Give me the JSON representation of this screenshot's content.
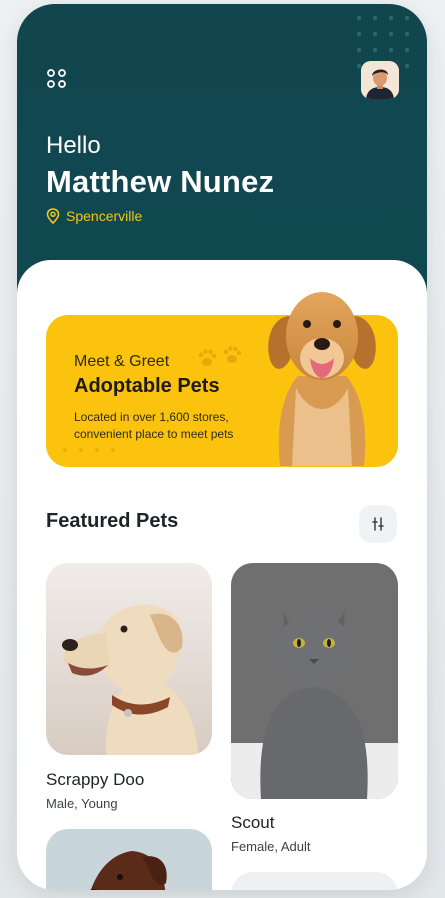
{
  "user": {
    "greeting": "Hello",
    "name": "Matthew Nunez",
    "location": "Spencerville"
  },
  "banner": {
    "subtitle": "Meet & Greet",
    "title": "Adoptable Pets",
    "description": "Located in over 1,600 stores, convenient place to meet pets"
  },
  "featured": {
    "title": "Featured Pets",
    "pets": [
      {
        "name": "Scrappy Doo",
        "info": "Male, Young"
      },
      {
        "name": "Scout",
        "info": "Female, Adult"
      }
    ]
  },
  "colors": {
    "header_bg": "#11464f",
    "accent_yellow": "#fcc30e",
    "location_yellow": "#f5c518"
  },
  "icons": [
    "menu-icon",
    "location-pin-icon",
    "paw-icon",
    "filter-icon"
  ]
}
